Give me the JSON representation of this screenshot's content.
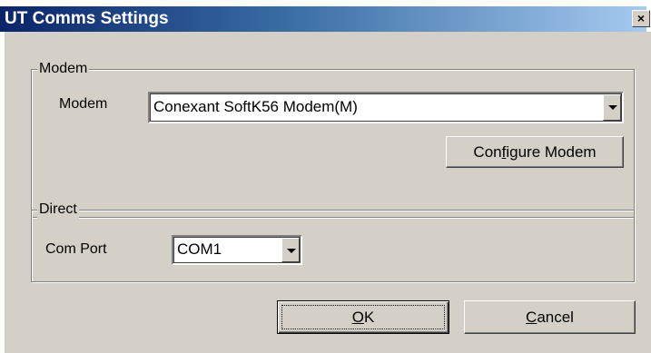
{
  "window": {
    "title": "UT Comms Settings",
    "close_glyph": "×"
  },
  "modem_group": {
    "label": "Modem",
    "field_label": "Modem",
    "selected": "Conexant SoftK56 Modem(M)",
    "configure_button": {
      "prefix": "Con",
      "mnemonic": "f",
      "suffix": "igure Modem"
    }
  },
  "direct_group": {
    "label": "Direct",
    "field_label": "Com Port",
    "selected": "COM1"
  },
  "buttons": {
    "ok": {
      "mnemonic": "O",
      "suffix": "K"
    },
    "cancel": {
      "mnemonic": "C",
      "suffix": "ancel"
    }
  },
  "colors": {
    "face": "#d4d0c8",
    "title_active": "#0a246a",
    "title_gradient_end": "#a6caf0"
  },
  "icons": {
    "close": "close-icon",
    "dropdown": "chevron-down-icon"
  }
}
